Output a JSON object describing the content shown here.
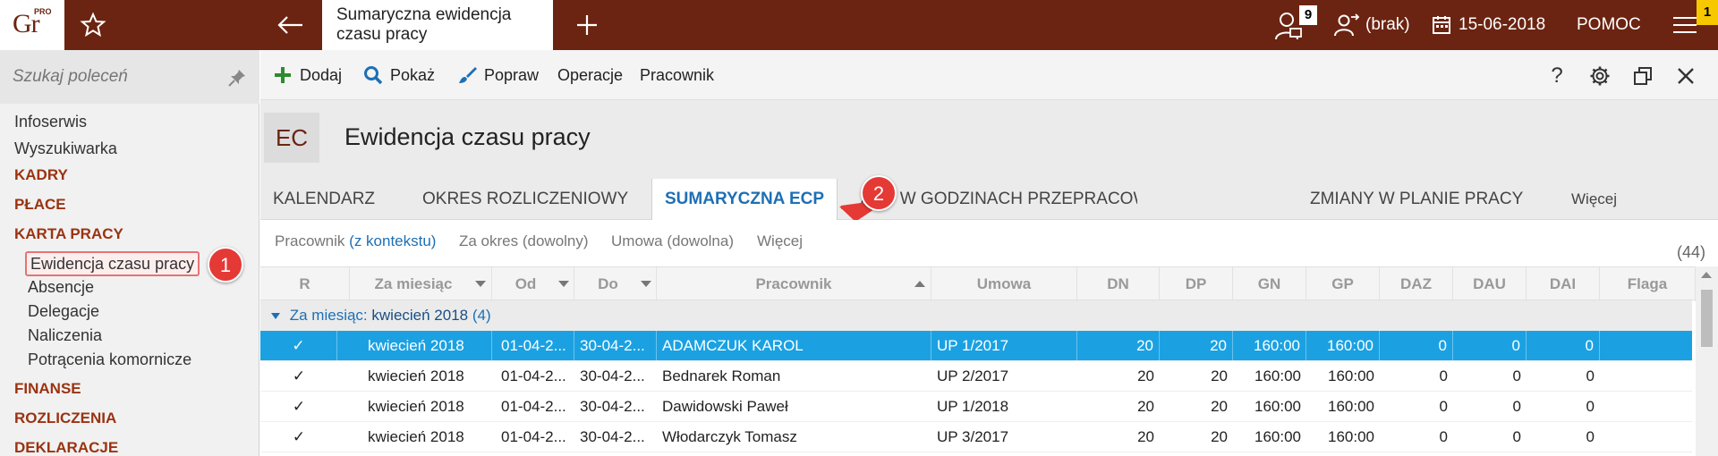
{
  "topbar": {
    "logo_text": "Gr",
    "logo_sup": "PRO",
    "doc_tab_title": "Sumaryczna ewidencja czasu pracy",
    "notif_count": "9",
    "user": "(brak)",
    "date": "15-06-2018",
    "help": "POMOC",
    "corner_badge": "1"
  },
  "sidebar": {
    "search_placeholder": "Szukaj poleceń",
    "items": {
      "infoserwis": "Infoserwis",
      "wyszukiwarka": "Wyszukiwarka",
      "kadry": "KADRY",
      "place": "PŁACE",
      "karta_pracy": "KARTA PRACY",
      "ewidencja": "Ewidencja czasu pracy",
      "absencje": "Absencje",
      "delegacje": "Delegacje",
      "naliczenia": "Naliczenia",
      "potracenia": "Potrącenia komornicze",
      "finanse": "FINANSE",
      "rozliczenia": "ROZLICZENIA",
      "deklaracje": "DEKLARACJE"
    },
    "callout_1": "1"
  },
  "toolbar": {
    "dodaj": "Dodaj",
    "pokaz": "Pokaż",
    "popraw": "Popraw",
    "operacje": "Operacje",
    "pracownik": "Pracownik",
    "help": "?"
  },
  "module": {
    "badge": "EC",
    "title": "Ewidencja czasu pracy"
  },
  "tabs": {
    "kalendarz": "KALENDARZ",
    "okres": "OKRES ROZLICZENIOWY",
    "sumaryczna": "SUMARYCZNA ECP",
    "zmiany_godz": "ZMIANY W GODZINACH PRZEPRACOWANYCH",
    "zmiany_godz_hidden": "ZMIANY W GODZINACH PRZEPRACOWANYCH",
    "zmiany_plan": "ZMIANY W PLANIE PRACY",
    "wiecej": "Więcej",
    "callout_2": "2"
  },
  "filters": {
    "pracownik_label": "Pracownik",
    "pracownik_ctx": "(z kontekstu)",
    "za_okres": "Za okres (dowolny)",
    "umowa": "Umowa (dowolna)",
    "wiecej": "Więcej",
    "count": "(44)"
  },
  "grid": {
    "columns": {
      "r": "R",
      "miesiac": "Za miesiąc",
      "od": "Od",
      "do": "Do",
      "pracownik": "Pracownik",
      "umowa": "Umowa",
      "dn": "DN",
      "dp": "DP",
      "gn": "GN",
      "gp": "GP",
      "daz": "DAZ",
      "dau": "DAU",
      "dai": "DAI",
      "flaga": "Flaga"
    },
    "group_label": "Za miesiąc:",
    "group_value": "kwiecień 2018",
    "group_count": "(4)",
    "rows": [
      {
        "r": "✓",
        "miesiac": "kwiecień 2018",
        "od": "01-04-2...",
        "do": "30-04-2...",
        "pracownik": "ADAMCZUK KAROL",
        "umowa": "UP 1/2017",
        "dn": "20",
        "dp": "20",
        "gn": "160:00",
        "gp": "160:00",
        "daz": "0",
        "dau": "0",
        "dai": "0"
      },
      {
        "r": "✓",
        "miesiac": "kwiecień 2018",
        "od": "01-04-2...",
        "do": "30-04-2...",
        "pracownik": "Bednarek Roman",
        "umowa": "UP 2/2017",
        "dn": "20",
        "dp": "20",
        "gn": "160:00",
        "gp": "160:00",
        "daz": "0",
        "dau": "0",
        "dai": "0"
      },
      {
        "r": "✓",
        "miesiac": "kwiecień 2018",
        "od": "01-04-2...",
        "do": "30-04-2...",
        "pracownik": "Dawidowski Paweł",
        "umowa": "UP 1/2018",
        "dn": "20",
        "dp": "20",
        "gn": "160:00",
        "gp": "160:00",
        "daz": "0",
        "dau": "0",
        "dai": "0"
      },
      {
        "r": "✓",
        "miesiac": "kwiecień 2018",
        "od": "01-04-2...",
        "do": "30-04-2...",
        "pracownik": "Włodarczyk Tomasz",
        "umowa": "UP 3/2017",
        "dn": "20",
        "dp": "20",
        "gn": "160:00",
        "gp": "160:00",
        "daz": "0",
        "dau": "0",
        "dai": "0"
      }
    ]
  },
  "colors": {
    "brand": "#6b2411",
    "accent": "#1e6fb5",
    "selection": "#1ba1e2",
    "callout": "#e53935"
  }
}
